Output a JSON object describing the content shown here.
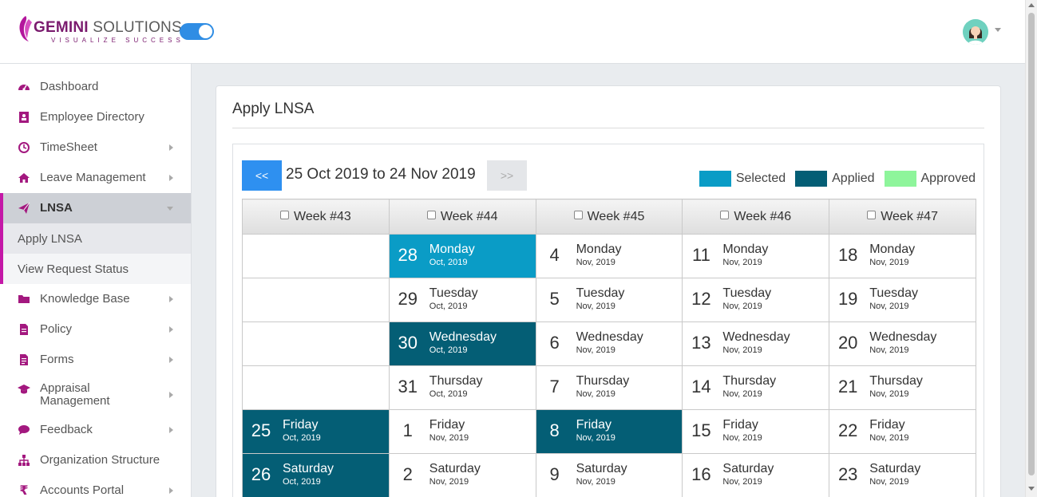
{
  "header": {
    "brand_main": "GEMINI",
    "brand_rest": " SOLUTIONS",
    "tagline": "VISUALIZE SUCCESS",
    "toggle_on": true
  },
  "sidebar": {
    "items": [
      {
        "label": "Dashboard",
        "icon": "dashboard-icon",
        "has_arrow": false
      },
      {
        "label": "Employee Directory",
        "icon": "address-book-icon",
        "has_arrow": false
      },
      {
        "label": "TimeSheet",
        "icon": "clock-icon",
        "has_arrow": true
      },
      {
        "label": "Leave Management",
        "icon": "home-icon",
        "has_arrow": true
      },
      {
        "label": "LNSA",
        "icon": "paper-plane-icon",
        "has_arrow": true,
        "active": true
      },
      {
        "label": "Knowledge Base",
        "icon": "folder-icon",
        "has_arrow": true
      },
      {
        "label": "Policy",
        "icon": "file-icon",
        "has_arrow": true
      },
      {
        "label": "Forms",
        "icon": "form-icon",
        "has_arrow": true
      },
      {
        "label": "Appraisal Management",
        "icon": "graduation-cap-icon",
        "has_arrow": true
      },
      {
        "label": "Feedback",
        "icon": "comments-icon",
        "has_arrow": true
      },
      {
        "label": "Organization Structure",
        "icon": "sitemap-icon",
        "has_arrow": false
      },
      {
        "label": "Accounts Portal",
        "icon": "rupee-icon",
        "has_arrow": true
      }
    ],
    "lnsa_sub": [
      {
        "label": "Apply LNSA",
        "current": true
      },
      {
        "label": "View Request Status",
        "current": false
      }
    ]
  },
  "page": {
    "title": "Apply LNSA",
    "prev_label": "<<",
    "next_label": ">>",
    "range_label": "25 Oct 2019 to 24 Nov 2019"
  },
  "legend": [
    {
      "label": "Selected",
      "color": "#0a9cc6"
    },
    {
      "label": "Applied",
      "color": "#045e75"
    },
    {
      "label": "Approved",
      "color": "#8ef59b"
    }
  ],
  "colors": {
    "accent": "#c418a7",
    "primary_button": "#2e90f0",
    "selected": "#0a9cc6",
    "applied": "#045e75",
    "approved": "#8ef59b"
  },
  "weeks": [
    {
      "label": "Week #43",
      "days": [
        null,
        null,
        null,
        null,
        {
          "d": "25",
          "wd": "Friday",
          "mo": "Oct, 2019",
          "status": "applied"
        },
        {
          "d": "26",
          "wd": "Saturday",
          "mo": "Oct, 2019",
          "status": "applied"
        }
      ]
    },
    {
      "label": "Week #44",
      "days": [
        {
          "d": "28",
          "wd": "Monday",
          "mo": "Oct, 2019",
          "status": "selected"
        },
        {
          "d": "29",
          "wd": "Tuesday",
          "mo": "Oct, 2019",
          "status": ""
        },
        {
          "d": "30",
          "wd": "Wednesday",
          "mo": "Oct, 2019",
          "status": "applied"
        },
        {
          "d": "31",
          "wd": "Thursday",
          "mo": "Oct, 2019",
          "status": ""
        },
        {
          "d": "1",
          "wd": "Friday",
          "mo": "Nov, 2019",
          "status": ""
        },
        {
          "d": "2",
          "wd": "Saturday",
          "mo": "Nov, 2019",
          "status": ""
        }
      ]
    },
    {
      "label": "Week #45",
      "days": [
        {
          "d": "4",
          "wd": "Monday",
          "mo": "Nov, 2019",
          "status": ""
        },
        {
          "d": "5",
          "wd": "Tuesday",
          "mo": "Nov, 2019",
          "status": ""
        },
        {
          "d": "6",
          "wd": "Wednesday",
          "mo": "Nov, 2019",
          "status": ""
        },
        {
          "d": "7",
          "wd": "Thursday",
          "mo": "Nov, 2019",
          "status": ""
        },
        {
          "d": "8",
          "wd": "Friday",
          "mo": "Nov, 2019",
          "status": "applied"
        },
        {
          "d": "9",
          "wd": "Saturday",
          "mo": "Nov, 2019",
          "status": ""
        }
      ]
    },
    {
      "label": "Week #46",
      "days": [
        {
          "d": "11",
          "wd": "Monday",
          "mo": "Nov, 2019",
          "status": ""
        },
        {
          "d": "12",
          "wd": "Tuesday",
          "mo": "Nov, 2019",
          "status": ""
        },
        {
          "d": "13",
          "wd": "Wednesday",
          "mo": "Nov, 2019",
          "status": ""
        },
        {
          "d": "14",
          "wd": "Thursday",
          "mo": "Nov, 2019",
          "status": ""
        },
        {
          "d": "15",
          "wd": "Friday",
          "mo": "Nov, 2019",
          "status": ""
        },
        {
          "d": "16",
          "wd": "Saturday",
          "mo": "Nov, 2019",
          "status": ""
        }
      ]
    },
    {
      "label": "Week #47",
      "days": [
        {
          "d": "18",
          "wd": "Monday",
          "mo": "Nov, 2019",
          "status": ""
        },
        {
          "d": "19",
          "wd": "Tuesday",
          "mo": "Nov, 2019",
          "status": ""
        },
        {
          "d": "20",
          "wd": "Wednesday",
          "mo": "Nov, 2019",
          "status": ""
        },
        {
          "d": "21",
          "wd": "Thursday",
          "mo": "Nov, 2019",
          "status": ""
        },
        {
          "d": "22",
          "wd": "Friday",
          "mo": "Nov, 2019",
          "status": ""
        },
        {
          "d": "23",
          "wd": "Saturday",
          "mo": "Nov, 2019",
          "status": ""
        }
      ]
    }
  ]
}
